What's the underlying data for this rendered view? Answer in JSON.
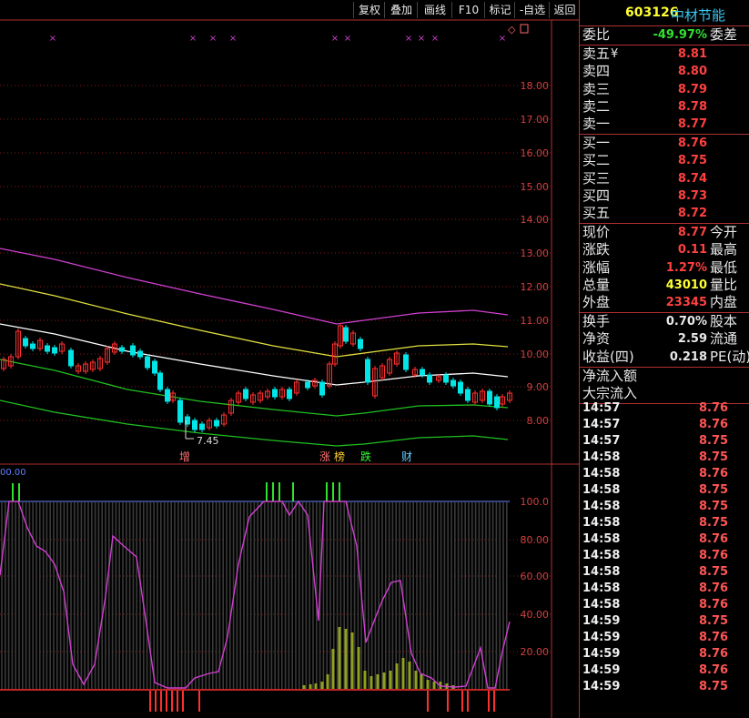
{
  "toolbar": [
    "复权",
    "叠加",
    "画线",
    "F10",
    "标记",
    "-自选",
    "返回"
  ],
  "stock": {
    "code": "603126",
    "name": "中材节能"
  },
  "weibi": {
    "label": "委比",
    "value": "-49.97%",
    "label2": "委差"
  },
  "asks": [
    {
      "label": "卖五",
      "value": "8.81",
      "extra": "¥"
    },
    {
      "label": "卖四",
      "value": "8.80"
    },
    {
      "label": "卖三",
      "value": "8.79"
    },
    {
      "label": "卖二",
      "value": "8.78"
    },
    {
      "label": "卖一",
      "value": "8.77"
    }
  ],
  "bids": [
    {
      "label": "买一",
      "value": "8.76"
    },
    {
      "label": "买二",
      "value": "8.75"
    },
    {
      "label": "买三",
      "value": "8.74"
    },
    {
      "label": "买四",
      "value": "8.73"
    },
    {
      "label": "买五",
      "value": "8.72"
    }
  ],
  "quote": [
    {
      "label": "现价",
      "value": "8.77",
      "color": "red",
      "label2": "今开"
    },
    {
      "label": "涨跌",
      "value": "0.11",
      "color": "red",
      "label2": "最高"
    },
    {
      "label": "涨幅",
      "value": "1.27%",
      "color": "red",
      "label2": "最低"
    },
    {
      "label": "总量",
      "value": "43010",
      "color": "yellow",
      "label2": "量比"
    },
    {
      "label": "外盘",
      "value": "23345",
      "color": "red",
      "label2": "内盘"
    }
  ],
  "fundamentals": [
    {
      "label": "换手",
      "value": "0.70%",
      "label2": "股本"
    },
    {
      "label": "净资",
      "value": "2.59",
      "label2": "流通"
    },
    {
      "label": "收益(四)",
      "value": "0.218",
      "label2": "PE(动)"
    }
  ],
  "flow": [
    "净流入额",
    "大宗流入"
  ],
  "ticks": [
    {
      "time": "14:57",
      "price": "8.76"
    },
    {
      "time": "14:57",
      "price": "8.76"
    },
    {
      "time": "14:57",
      "price": "8.75"
    },
    {
      "time": "14:58",
      "price": "8.75"
    },
    {
      "time": "14:58",
      "price": "8.76"
    },
    {
      "time": "14:58",
      "price": "8.75"
    },
    {
      "time": "14:58",
      "price": "8.75"
    },
    {
      "time": "14:58",
      "price": "8.75"
    },
    {
      "time": "14:58",
      "price": "8.76"
    },
    {
      "time": "14:58",
      "price": "8.76"
    },
    {
      "time": "14:58",
      "price": "8.75"
    },
    {
      "time": "14:58",
      "price": "8.76"
    },
    {
      "time": "14:58",
      "price": "8.76"
    },
    {
      "time": "14:59",
      "price": "8.75"
    },
    {
      "time": "14:59",
      "price": "8.76"
    },
    {
      "time": "14:59",
      "price": "8.76"
    },
    {
      "time": "14:59",
      "price": "8.76"
    },
    {
      "time": "14:59",
      "price": "8.75"
    }
  ],
  "price_axis": [
    "18.00",
    "17.00",
    "16.00",
    "15.00",
    "14.00",
    "13.00",
    "12.00",
    "11.00",
    "10.00",
    "9.00",
    "8.00"
  ],
  "ind_axis": [
    "100.0",
    "80.00",
    "60.00",
    "40.00",
    "20.00"
  ],
  "ind_label": "00.00",
  "low_label": "7.45",
  "event_tags": [
    {
      "text": "增",
      "color": "#ff7070"
    },
    {
      "text": "涨",
      "color": "#ff7070"
    },
    {
      "text": "榜",
      "color": "#ffcc33"
    },
    {
      "text": "跌",
      "color": "#33ff33"
    },
    {
      "text": "财",
      "color": "#66ccff"
    }
  ],
  "colors": {
    "up": "#ff3030",
    "down": "#00e5e5",
    "ma_top": "#d040d0",
    "ma_mid": "#e0e040",
    "ma_low": "#ffffff",
    "ma_bot1": "#20c020",
    "ma_bot2": "#20c020"
  }
}
